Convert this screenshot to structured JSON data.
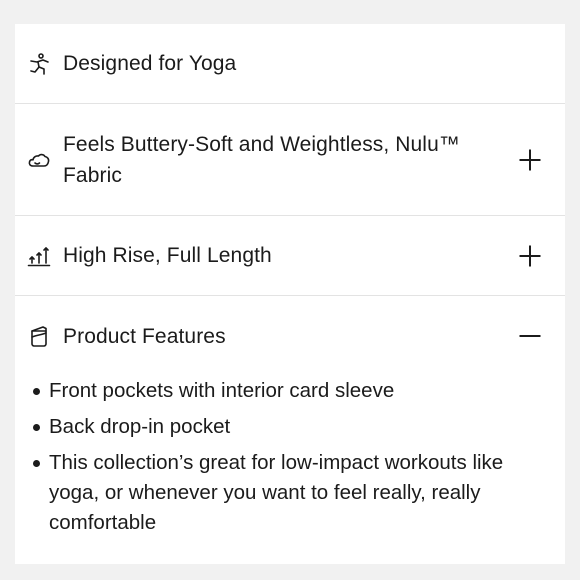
{
  "sections": [
    {
      "icon": "yoga-pose-icon",
      "label": "Designed for Yoga",
      "toggle": ""
    },
    {
      "icon": "cloud-icon",
      "label": "Feels Buttery-Soft and Weightless, Nulu™ Fabric",
      "toggle": "plus"
    },
    {
      "icon": "rise-arrows-icon",
      "label": "High Rise, Full Length",
      "toggle": "plus"
    },
    {
      "icon": "features-box-icon",
      "label": "Product Features",
      "toggle": "minus"
    }
  ],
  "product_features": [
    "Front pockets with interior card sleeve",
    "Back drop-in pocket",
    "This collection’s great for low-impact workouts like yoga, or whenever you want to feel really, really comfortable"
  ]
}
